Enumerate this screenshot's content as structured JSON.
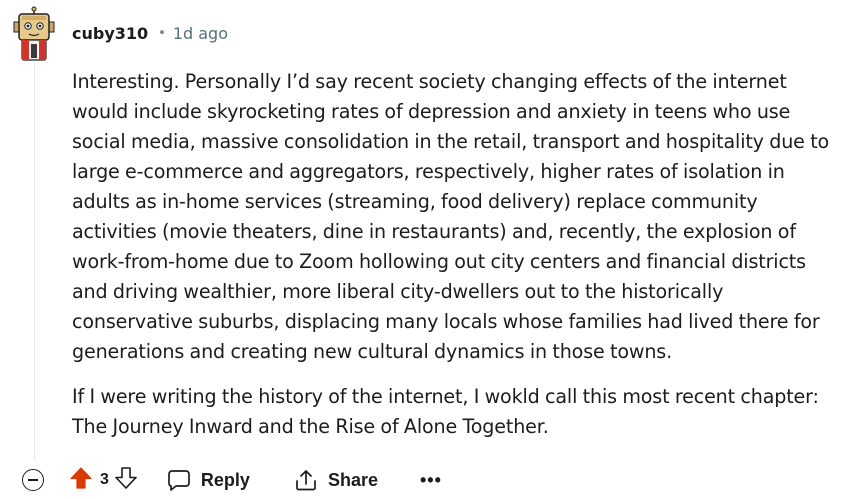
{
  "comment": {
    "username": "cuby310",
    "separator": "•",
    "timestamp": "1d ago",
    "paragraphs": [
      "Interesting. Personally I’d say recent society changing effects of the internet would include skyrocketing rates of depression and anxiety in teens who use social media, massive consolidation in the retail, transport and hospitality due to large e-commerce and aggregators, respectively, higher rates of isolation in adults as in-home services (streaming, food delivery) replace community activities (movie theaters, dine in restaurants) and, recently, the explosion of work-from-home due to Zoom hollowing out city centers and financial districts and driving wealthier, more liberal city-dwellers out to the historically conservative suburbs, displacing many locals whose families had lived there for generations and creating new cultural dynamics in those towns.",
      "If I were writing the history of the internet, I wokld call this most recent chapter: The Journey Inward and the Rise of Alone Together."
    ]
  },
  "actions": {
    "vote_count": "3",
    "reply_label": "Reply",
    "share_label": "Share",
    "more_label": "•••",
    "upvote_color": "#d93a00"
  },
  "icons": {
    "avatar": "avatar-icon",
    "collapse": "collapse-icon",
    "upvote": "upvote-arrow-icon",
    "downvote": "downvote-arrow-icon",
    "reply": "comment-bubble-icon",
    "share": "share-icon",
    "more": "more-dots-icon"
  }
}
